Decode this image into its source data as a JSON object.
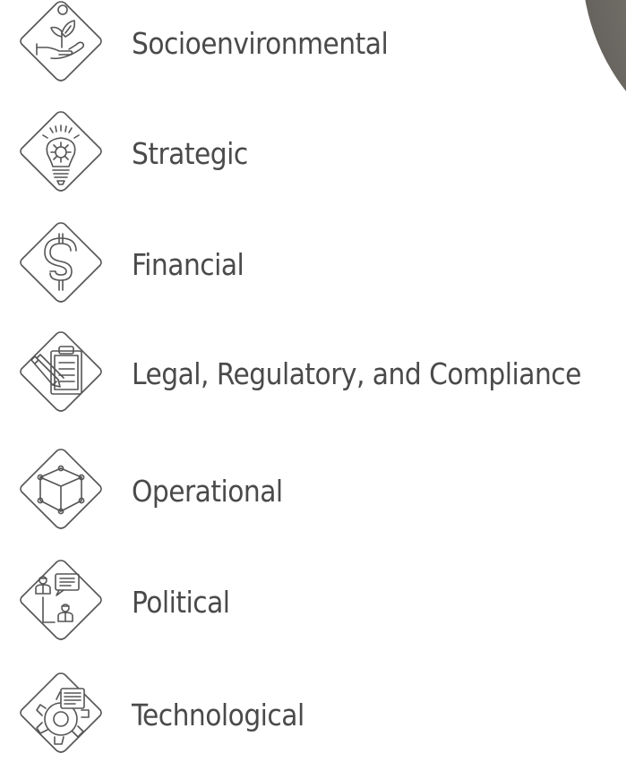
{
  "risk_categories": [
    {
      "label": "Socioenvironmental",
      "icon": "hand-plant-icon"
    },
    {
      "label": "Strategic",
      "icon": "lightbulb-gear-icon"
    },
    {
      "label": "Financial",
      "icon": "dollar-icon"
    },
    {
      "label": "Legal, Regulatory, and Compliance",
      "icon": "clipboard-pen-icon"
    },
    {
      "label": "Operational",
      "icon": "cube-network-icon"
    },
    {
      "label": "Political",
      "icon": "people-dialogue-icon"
    },
    {
      "label": "Technological",
      "icon": "gear-screen-icon"
    }
  ],
  "colors": {
    "text": "#4a4a4a",
    "icon_stroke": "#555555",
    "background": "#ffffff"
  }
}
